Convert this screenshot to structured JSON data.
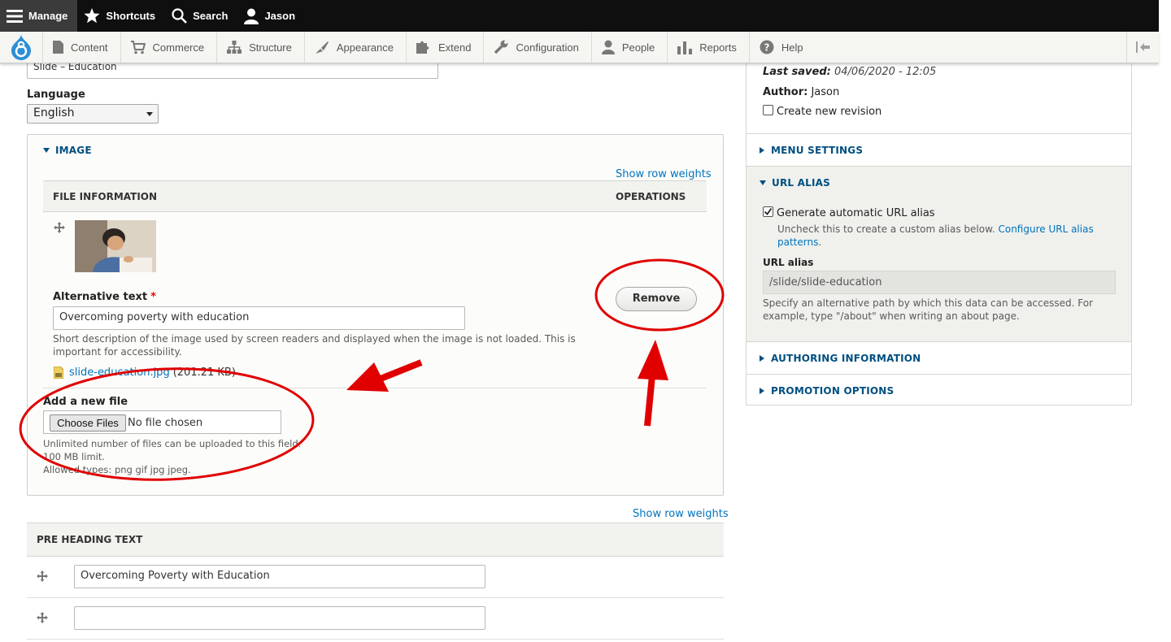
{
  "toolbar": {
    "manage": "Manage",
    "shortcuts": "Shortcuts",
    "search": "Search",
    "user": "Jason"
  },
  "admin_menu": {
    "items": [
      {
        "label": "Content",
        "icon": "file-icon"
      },
      {
        "label": "Commerce",
        "icon": "cart-icon"
      },
      {
        "label": "Structure",
        "icon": "sitemap-icon"
      },
      {
        "label": "Appearance",
        "icon": "brush-icon"
      },
      {
        "label": "Extend",
        "icon": "puzzle-icon"
      },
      {
        "label": "Configuration",
        "icon": "wrench-icon"
      },
      {
        "label": "People",
        "icon": "person-icon"
      },
      {
        "label": "Reports",
        "icon": "bar-chart-icon"
      },
      {
        "label": "Help",
        "icon": "help-icon"
      }
    ]
  },
  "form": {
    "title_value": "Slide – Education",
    "language_label": "Language",
    "language_value": "English",
    "image": {
      "summary": "IMAGE",
      "show_row_weights": "Show row weights",
      "col_file_info": "FILE INFORMATION",
      "col_operations": "OPERATIONS",
      "alt_label": "Alternative text",
      "alt_required": "*",
      "alt_value": "Overcoming poverty with education",
      "alt_desc_1": "Short description of the image used by screen readers and displayed when the image is not loaded. This is",
      "alt_desc_2": "important for accessibility.",
      "file_name": "slide-education.jpg",
      "file_size": "(201.21 KB)",
      "remove": "Remove",
      "add_new_label": "Add a new file",
      "choose_files": "Choose Files",
      "no_file": "No file chosen",
      "help_1": "Unlimited number of files can be uploaded to this field.",
      "help_2": "100 MB limit.",
      "help_3": "Allowed types: png gif jpg jpeg."
    },
    "pre_heading": {
      "show_row_weights": "Show row weights",
      "header": "PRE HEADING TEXT",
      "row1_value": "Overcoming Poverty with Education",
      "row2_value": ""
    }
  },
  "sidebar": {
    "last_saved_label": "Last saved:",
    "last_saved_value": "04/06/2020 - 12:05",
    "author_label": "Author:",
    "author_value": "Jason",
    "create_revision": "Create new revision",
    "create_revision_checked": false,
    "menu_settings": "MENU SETTINGS",
    "url_alias": {
      "summary": "URL ALIAS",
      "generate_label": "Generate automatic URL alias",
      "generate_checked": true,
      "uncheck_desc": "Uncheck this to create a custom alias below.",
      "configure_link_1": "Configure URL alias",
      "configure_link_2": "patterns",
      "alias_label": "URL alias",
      "alias_value": "/slide/slide-education",
      "alias_desc_1": "Specify an alternative path by which this data can be accessed. For",
      "alias_desc_2": "example, type \"/about\" when writing an about page."
    },
    "authoring_information": "AUTHORING INFORMATION",
    "promotion_options": "PROMOTION OPTIONS"
  },
  "colors": {
    "link": "#0074bd",
    "summary": "#004f80",
    "annotation": "#e00000",
    "toolbar_bg": "#0f0f0f"
  }
}
